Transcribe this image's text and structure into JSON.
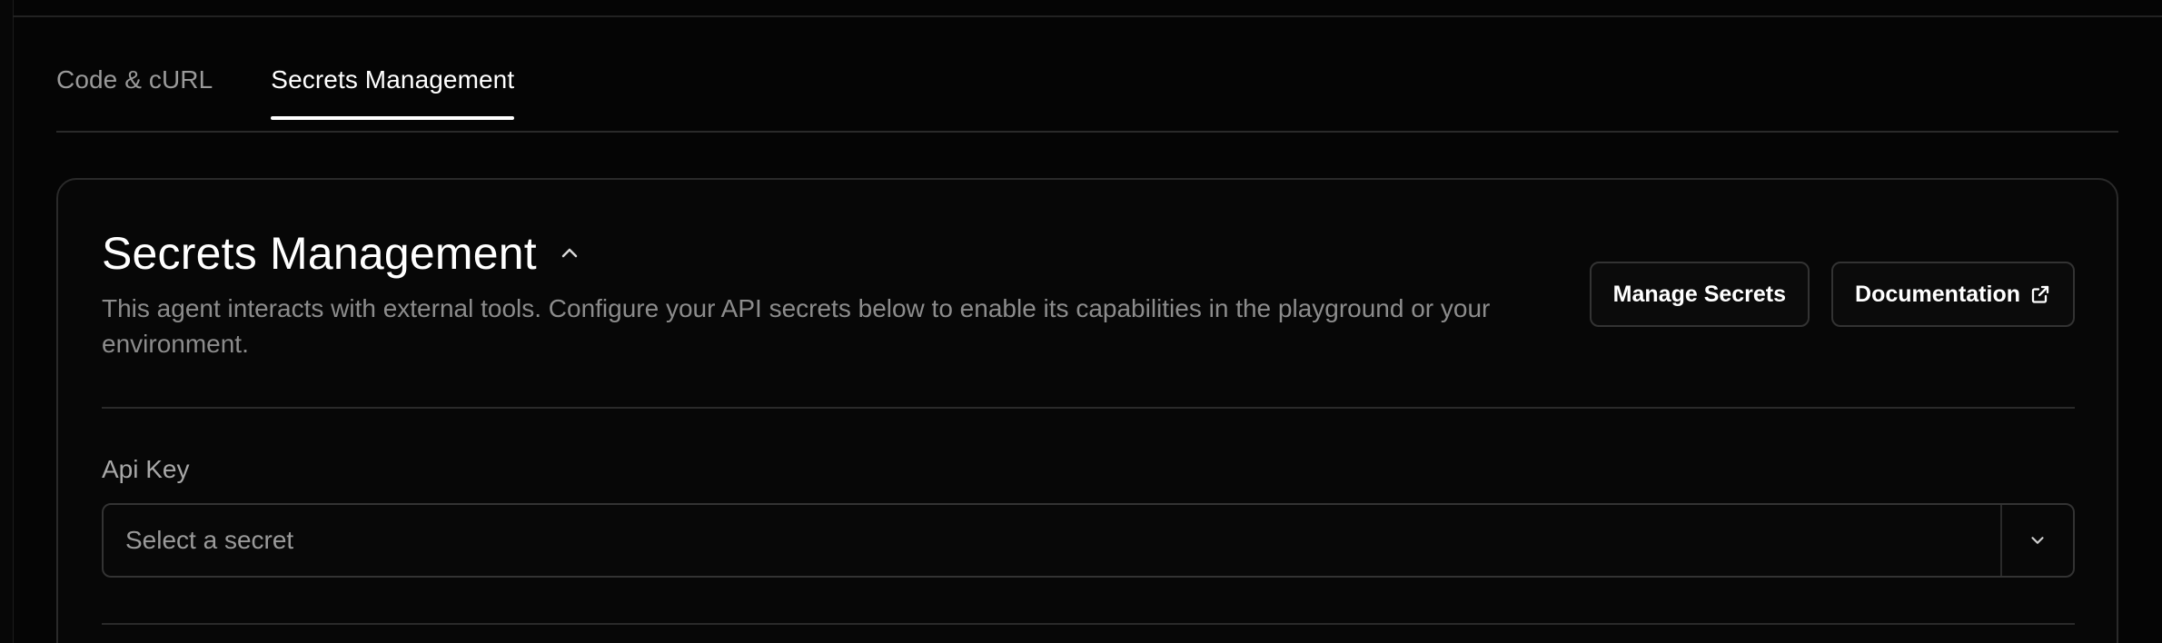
{
  "tabs": [
    {
      "label": "Code & cURL",
      "active": false
    },
    {
      "label": "Secrets Management",
      "active": true
    }
  ],
  "card": {
    "title": "Secrets Management",
    "description": "This agent interacts with external tools. Configure your API secrets below to enable its capabilities in the playground or your environment.",
    "actions": {
      "manage_label": "Manage Secrets",
      "docs_label": "Documentation"
    },
    "field": {
      "label": "Api Key",
      "select_placeholder": "Select a secret"
    }
  },
  "icons": {
    "collapse": "chevron-up-icon",
    "external": "external-link-icon",
    "dropdown": "chevron-down-icon"
  },
  "colors": {
    "background": "#050505",
    "card_border": "#2a2a2a",
    "text_primary": "#ffffff",
    "text_muted": "#8c8c8c"
  }
}
